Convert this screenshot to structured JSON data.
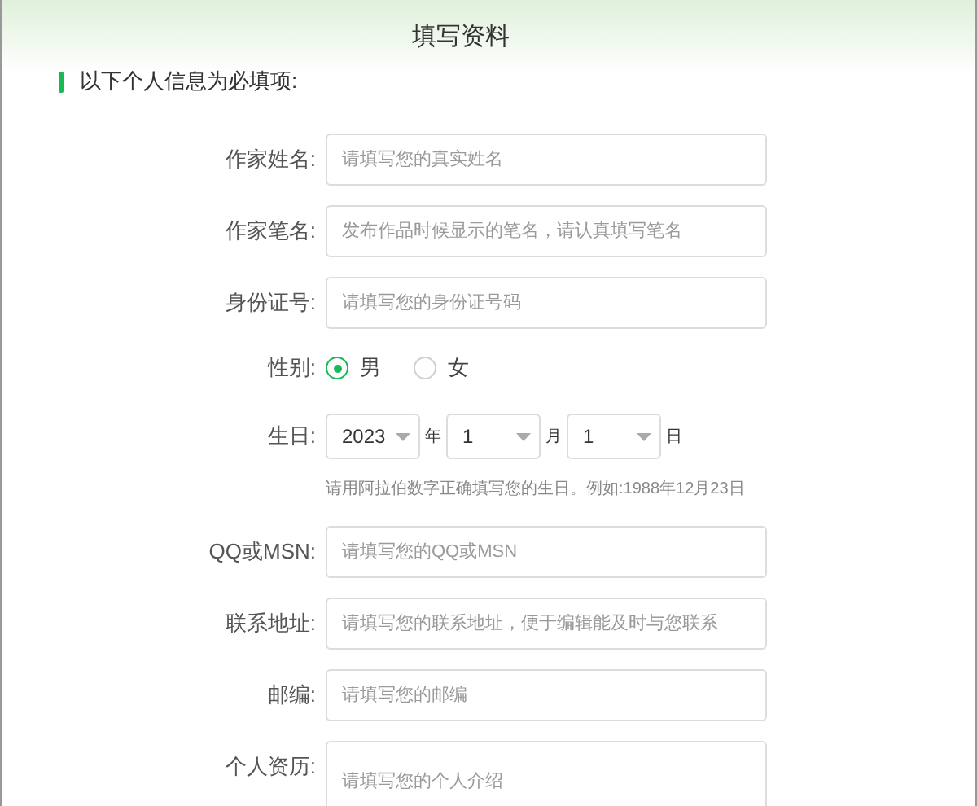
{
  "title": "填写资料",
  "section": "以下个人信息为必填项:",
  "fields": [
    {
      "kind": "text",
      "label": "作家姓名:",
      "placeholder": "请填写您的真实姓名"
    },
    {
      "kind": "text",
      "label": "作家笔名:",
      "placeholder": "发布作品时候显示的笔名，请认真填写笔名"
    },
    {
      "kind": "text",
      "label": "身份证号:",
      "placeholder": "请填写您的身份证号码"
    },
    {
      "kind": "radio",
      "label": "性别:",
      "options": [
        {
          "label": "男",
          "selected": true
        },
        {
          "label": "女",
          "selected": false
        }
      ]
    },
    {
      "kind": "date",
      "label": "生日:",
      "parts": [
        {
          "value": "2023",
          "unit": "年"
        },
        {
          "value": "1",
          "unit": "月"
        },
        {
          "value": "1",
          "unit": "日"
        }
      ],
      "hint": "请用阿拉伯数字正确填写您的生日。例如:1988年12月23日"
    },
    {
      "kind": "text",
      "label": "QQ或MSN:",
      "placeholder": "请填写您的QQ或MSN"
    },
    {
      "kind": "text",
      "label": "联系地址:",
      "placeholder": "请填写您的联系地址，便于编辑能及时与您联系"
    },
    {
      "kind": "text",
      "label": "邮编:",
      "placeholder": "请填写您的邮编"
    },
    {
      "kind": "textarea",
      "label": "个人资历:",
      "placeholder": "请填写您的个人介绍"
    }
  ]
}
